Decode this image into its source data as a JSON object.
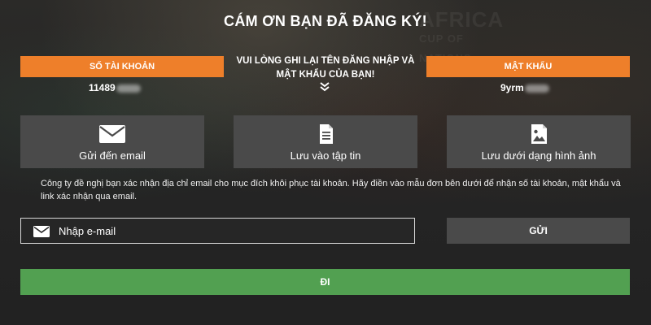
{
  "title": "CÁM ƠN BẠN ĐÃ ĐĂNG KÝ!",
  "background": {
    "watermark_line1": "AFRICA",
    "watermark_line2": "CUP OF NATIONS"
  },
  "account": {
    "label": "SỐ TÀI KHOẢN",
    "value": "11489"
  },
  "password": {
    "label": "MẬT KHẨU",
    "value": "9yrm"
  },
  "notice": {
    "line1": "VUI LÒNG GHI LẠI TÊN ĐĂNG NHẬP VÀ",
    "line2": "MẬT KHẨU CỦA BẠN!",
    "icon": "double-chevron-down-icon"
  },
  "actions": [
    {
      "label": "Gửi đến email",
      "icon": "envelope-icon"
    },
    {
      "label": "Lưu vào tập tin",
      "icon": "document-icon"
    },
    {
      "label": "Lưu dưới dạng hình ảnh",
      "icon": "image-icon"
    }
  ],
  "info_text": "Công ty đề nghị bạn xác nhận địa chỉ email cho mục đích khôi phục tài khoản. Hãy điền vào mẫu đơn bên dưới để nhận số tài khoản, mật khẩu và link xác nhận qua email.",
  "email_input": {
    "placeholder": "Nhập e-mail",
    "value": "",
    "icon": "envelope-icon"
  },
  "send_button": "GỬI",
  "go_button": "ĐI",
  "colors": {
    "accent_orange": "#ee7f2a",
    "button_gray": "#4a4a4a",
    "go_green": "#52a051",
    "background": "#232323"
  }
}
